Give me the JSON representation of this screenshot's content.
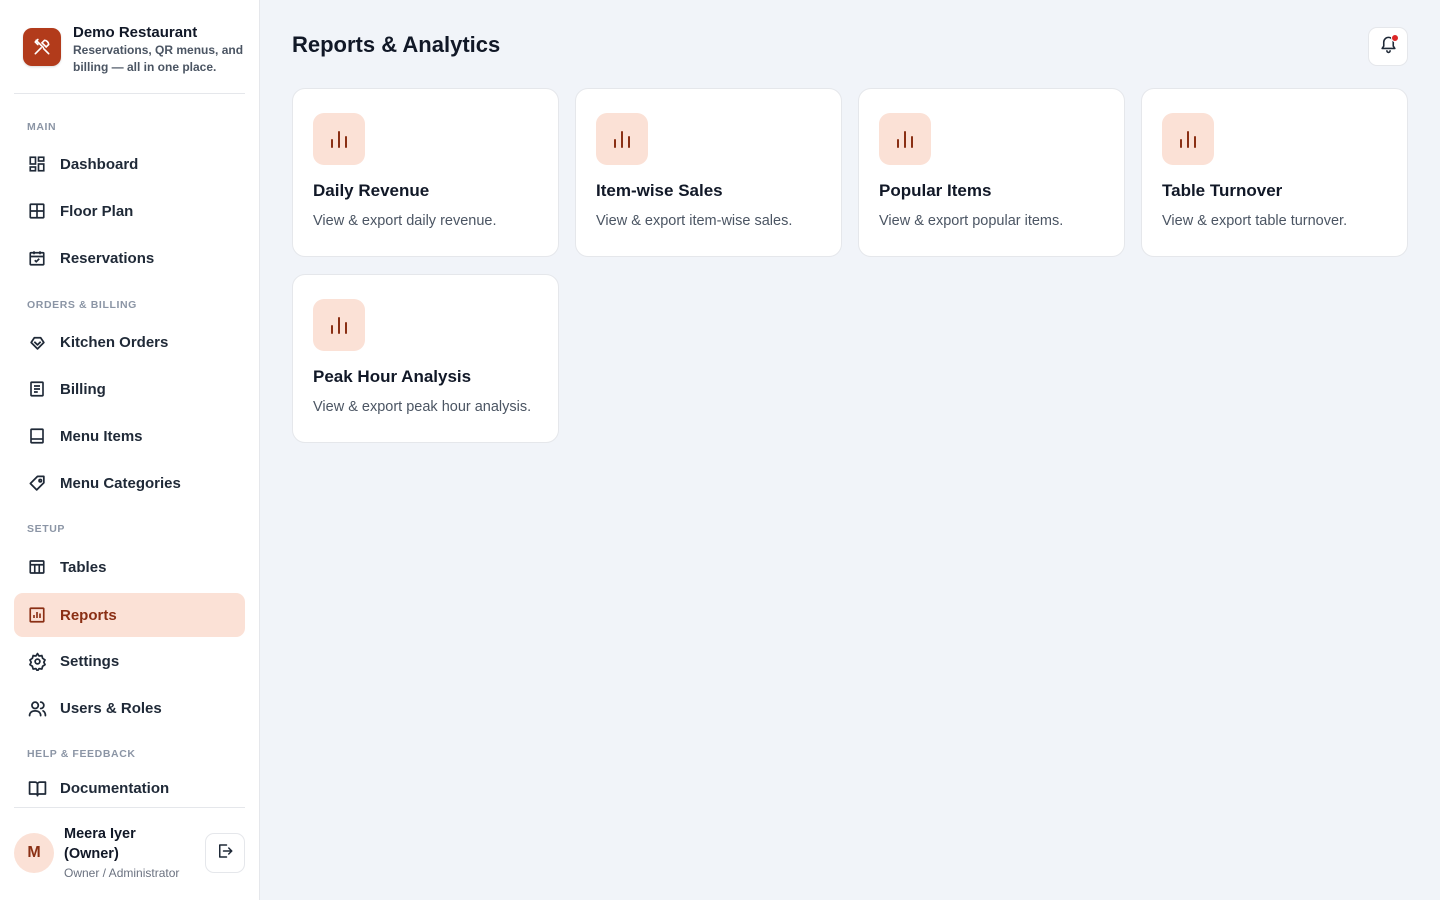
{
  "brand": {
    "name": "Demo Restaurant",
    "tagline": "Reservations, QR menus, and billing — all in one place."
  },
  "sidebar": {
    "sections": {
      "main": "MAIN",
      "orders": "ORDERS & BILLING",
      "setup": "SETUP",
      "help": "HELP & FEEDBACK"
    },
    "items": [
      {
        "label": "Dashboard",
        "icon": "dashboard-icon"
      },
      {
        "label": "Floor Plan",
        "icon": "grid-icon"
      },
      {
        "label": "Reservations",
        "icon": "calendar-check-icon"
      },
      {
        "label": "Kitchen Orders",
        "icon": "chef-hat-icon"
      },
      {
        "label": "Billing",
        "icon": "receipt-icon"
      },
      {
        "label": "Menu Items",
        "icon": "book-icon"
      },
      {
        "label": "Menu Categories",
        "icon": "tag-icon"
      },
      {
        "label": "Tables",
        "icon": "table-icon"
      },
      {
        "label": "Reports",
        "icon": "bar-chart-icon",
        "active": true
      },
      {
        "label": "Settings",
        "icon": "gear-icon"
      },
      {
        "label": "Users & Roles",
        "icon": "users-icon"
      },
      {
        "label": "Documentation",
        "icon": "open-book-icon"
      }
    ]
  },
  "user": {
    "initial": "M",
    "name": "Meera Iyer (Owner)",
    "role": "Owner / Administrator"
  },
  "header": {
    "title": "Reports & Analytics"
  },
  "reports": [
    {
      "title": "Daily Revenue",
      "desc": "View & export daily revenue."
    },
    {
      "title": "Item-wise Sales",
      "desc": "View & export item-wise sales."
    },
    {
      "title": "Popular Items",
      "desc": "View & export popular items."
    },
    {
      "title": "Table Turnover",
      "desc": "View & export table turnover."
    },
    {
      "title": "Peak Hour Analysis",
      "desc": "View & export peak hour analysis."
    }
  ],
  "colors": {
    "accent": "#b23b1b",
    "accent_soft": "#fbe1d6",
    "active_text": "#8a2f14"
  }
}
